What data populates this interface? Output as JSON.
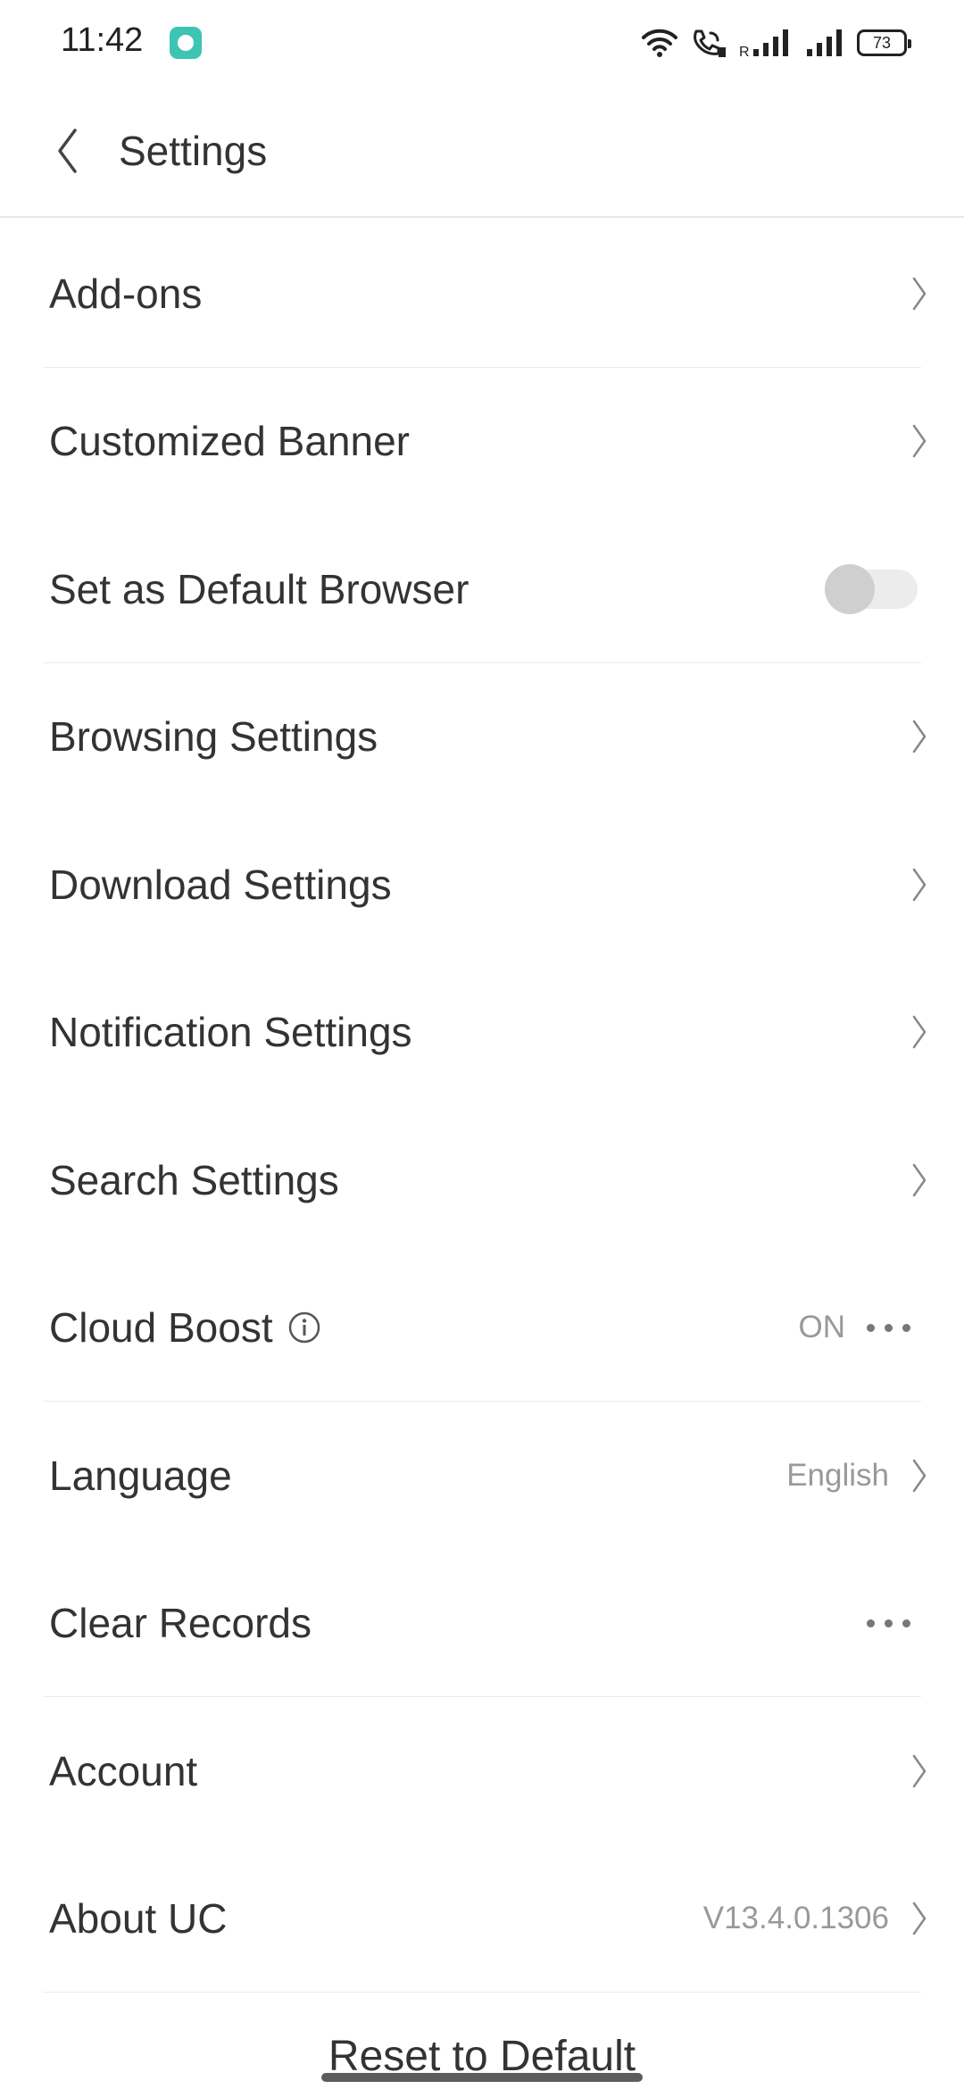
{
  "status_bar": {
    "time": "11:42",
    "battery": "73",
    "icons": [
      "app-notification-icon",
      "wifi-icon",
      "wifi-calling-icon",
      "signal-roaming-icon",
      "signal-icon",
      "battery-icon"
    ],
    "roaming_label": "R"
  },
  "header": {
    "title": "Settings",
    "back_icon": "chevron-left-icon"
  },
  "settings": {
    "items": [
      {
        "label": "Add-ons"
      },
      {
        "label": "Customized Banner"
      },
      {
        "label": "Set as Default Browser",
        "toggle_on": false
      },
      {
        "label": "Browsing Settings"
      },
      {
        "label": "Download Settings"
      },
      {
        "label": "Notification Settings"
      },
      {
        "label": "Search Settings"
      },
      {
        "label": "Cloud Boost",
        "value": "ON"
      },
      {
        "label": "Language",
        "value": "English"
      },
      {
        "label": "Clear Records"
      },
      {
        "label": "Account"
      },
      {
        "label": "About UC",
        "value": "V13.4.0.1306"
      }
    ]
  },
  "footer": {
    "reset_label": "Reset to Default"
  },
  "colors": {
    "text": "#333333",
    "secondary_text": "#999999",
    "divider": "#ececec",
    "toggle_track": "#ececec",
    "toggle_knob": "#cfcfcf",
    "app_icon": "#3cc4b4"
  }
}
